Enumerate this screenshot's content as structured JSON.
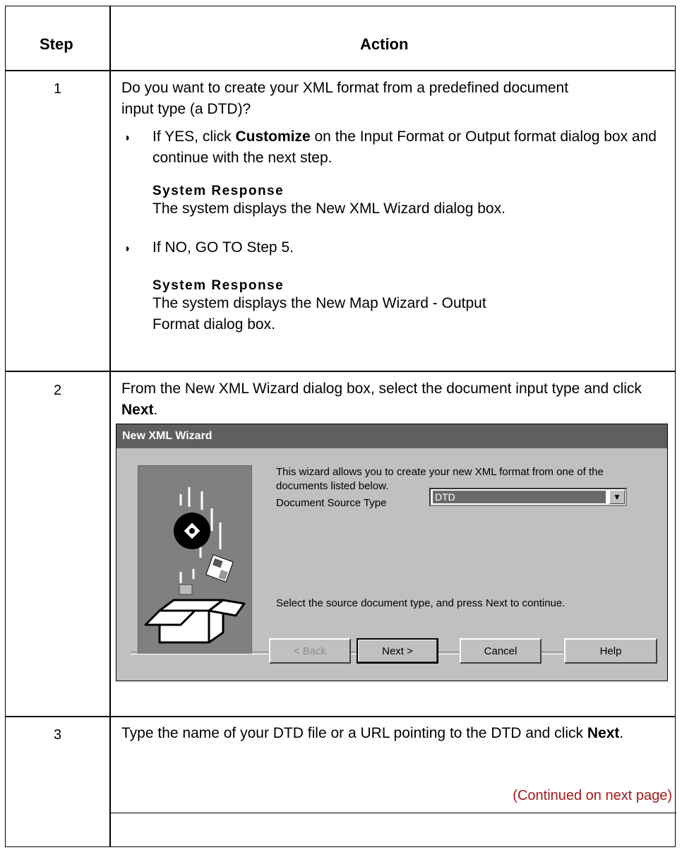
{
  "table": {
    "header_step": "Step",
    "header_action": "Action"
  },
  "step1": {
    "number": "1",
    "question": "Do you want to create your XML format from a predefined document input type (a DTD)?",
    "yes_pre": "If YES, click ",
    "yes_bold": "Customize",
    "yes_post": " on the Input Format or Output format dialog box and continue with the next step.",
    "resp1_title": "System Response",
    "resp1_text": "The system displays the New XML Wizard dialog box.",
    "no_text": "If NO, GO TO Step 5.",
    "resp2_title": "System Response",
    "resp2_text_line1": "The system displays the New Map Wizard - Output",
    "resp2_text_line2": "Format dialog box."
  },
  "step2": {
    "number": "2",
    "text_pre": "From the New XML Wizard dialog box, select the document input type and click ",
    "text_bold": "Next",
    "text_post": "."
  },
  "dialog": {
    "title": "New XML Wizard",
    "intro": "This wizard allows you to create your new XML format from one of the documents listed below.",
    "source_label": "Document Source Type",
    "source_value": "DTD",
    "instruction": "Select the source document type, and press Next to continue.",
    "back_label": "< Back",
    "next_label": "Next >",
    "cancel_label": "Cancel",
    "help_label": "Help"
  },
  "step3": {
    "number": "3",
    "text_pre": "Type the name of your DTD file or a URL pointing to the DTD and click ",
    "text_bold": "Next",
    "text_post": "."
  },
  "continued": "(Continued on next page)"
}
